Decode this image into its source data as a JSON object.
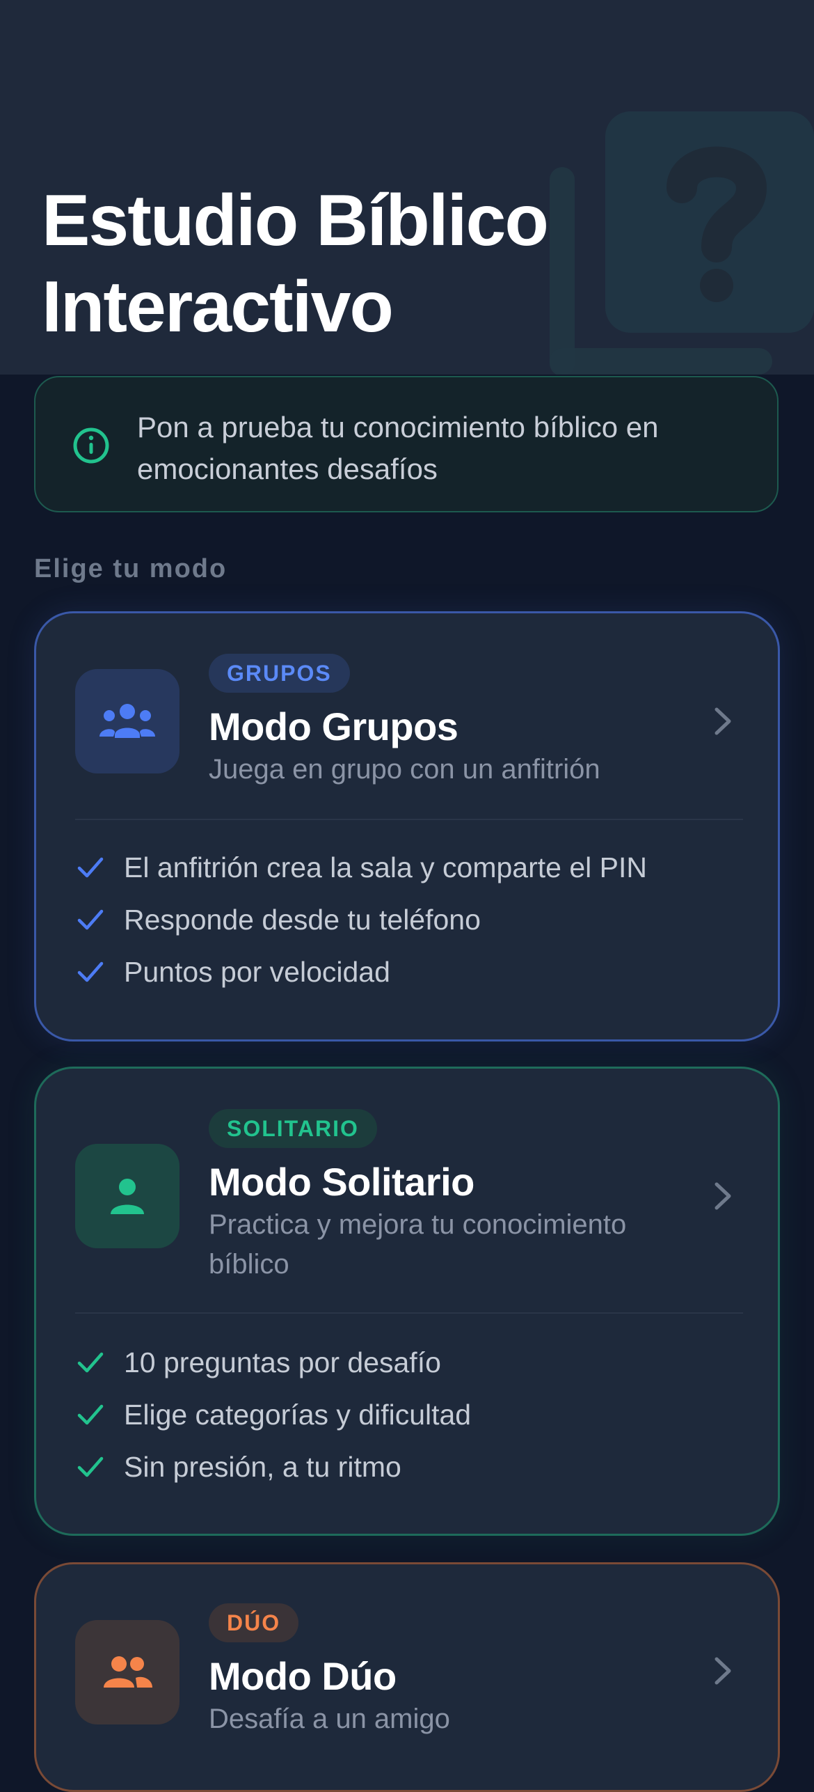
{
  "header": {
    "title_line1": "Estudio Bíblico",
    "title_line2": "Interactivo"
  },
  "info": {
    "icon": "info-icon",
    "text": "Pon a prueba tu conocimiento bíblico en emocionantes desafíos"
  },
  "section_label": "Elige tu modo",
  "modes": [
    {
      "badge": "GRUPOS",
      "title": "Modo Grupos",
      "subtitle": "Juega en grupo con un anfitrión",
      "icon": "group-icon",
      "accent": "#4d7cf5",
      "features": [
        "El anfitrión crea la sala y comparte el PIN",
        "Responde desde tu teléfono",
        "Puntos por velocidad"
      ]
    },
    {
      "badge": "SOLITARIO",
      "title": "Modo Solitario",
      "subtitle": "Practica y mejora tu conocimiento bíblico",
      "icon": "person-icon",
      "accent": "#22c38e",
      "features": [
        "10 preguntas por desafío",
        "Elige categorías y dificultad",
        "Sin presión, a tu ritmo"
      ]
    },
    {
      "badge": "DÚO",
      "title": "Modo Dúo",
      "subtitle": "Desafía a un amigo",
      "icon": "duo-icon",
      "accent": "#f5844a"
    }
  ],
  "colors": {
    "background": "#0f1729",
    "card": "#1e293b",
    "info_accent": "#22c38e"
  }
}
